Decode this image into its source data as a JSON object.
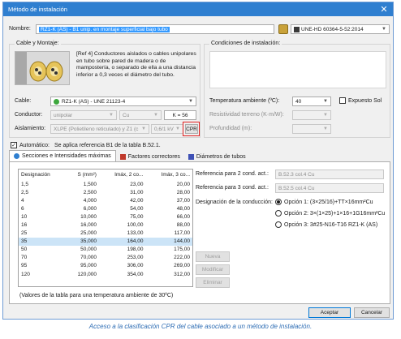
{
  "window": {
    "title": "Método de instalación",
    "close_glyph": "✕"
  },
  "nombre": {
    "label": "Nombre:",
    "value": "RZ1-K (AS) - B1 unip. en montaje superficial bajo tubo",
    "standard": "UNE-HD 60364-5-52:2014"
  },
  "cable_montaje": {
    "title": "Cable y Montaje:",
    "ref_text": "[Ref 4] Conductores aislados o cables unipolares en tubo sobre pared de madera o de mampostería, o separado de ella a una distancia inferior a 0,3 veces el diámetro del tubo.",
    "cable_label": "Cable:",
    "cable_value": "RZ1-K (AS) - UNE 21123-4",
    "conductor_label": "Conductor:",
    "conductor_value": "unipolar",
    "material_value": "Cu",
    "k_value": "K = 56",
    "aislamiento_label": "Aislamiento:",
    "aislamiento_value": "XLPE (Polietileno reticulado) y Z1 (c",
    "voltage_value": "0,6/1 kV",
    "cpr_label": "CPR"
  },
  "condiciones": {
    "title": "Condiciones de instalación:",
    "temp_label": "Temperatura ambiente (ºC):",
    "temp_value": "40",
    "expuesto_label": "Expuesto Sol",
    "resistividad_label": "Resistividad terreno (K·m/W):",
    "profundidad_label": "Profundidad (m):"
  },
  "automatico": {
    "label": "Automático:",
    "text": "Se aplica referencia B1 de la tabla B.52.1."
  },
  "tabs": [
    {
      "label": "Secciones e Intensidades máximas"
    },
    {
      "label": "Factores correctores"
    },
    {
      "label": "Diámetros de tubos"
    }
  ],
  "table": {
    "headers": [
      "Designación",
      "S (mm²)",
      "Imáx, 2 co...",
      "Imáx, 3 co..."
    ],
    "rows": [
      [
        "1,5",
        "1,500",
        "23,00",
        "20,00"
      ],
      [
        "2,5",
        "2,500",
        "31,00",
        "28,00"
      ],
      [
        "4",
        "4,000",
        "42,00",
        "37,00"
      ],
      [
        "6",
        "6,000",
        "54,00",
        "48,00"
      ],
      [
        "10",
        "10,000",
        "75,00",
        "66,00"
      ],
      [
        "16",
        "16,000",
        "100,00",
        "88,00"
      ],
      [
        "25",
        "25,000",
        "133,00",
        "117,00"
      ],
      [
        "35",
        "35,000",
        "164,00",
        "144,00"
      ],
      [
        "50",
        "50,000",
        "198,00",
        "175,00"
      ],
      [
        "70",
        "70,000",
        "253,00",
        "222,00"
      ],
      [
        "95",
        "95,000",
        "306,00",
        "269,00"
      ],
      [
        "120",
        "120,000",
        "354,00",
        "312,00"
      ]
    ],
    "selected_row": 7,
    "footnote": "(Valores de la tabla para una temperatura ambiente de 30ºC)"
  },
  "right_panel": {
    "ref2_label": "Referencia para 2 cond. act.:",
    "ref2_value": "B.52.3 col.4 Cu",
    "ref3_label": "Referencia para 3 cond. act.:",
    "ref3_value": "B.52.5 col.4 Cu",
    "designacion_label": "Designación de la conducción:",
    "options": [
      {
        "label": "Opción 1: (3×25/16)+TT×16mm²Cu",
        "checked": true
      },
      {
        "label": "Opción 2: 3×(1×25)+1×16+1G16mm²Cu",
        "checked": false
      },
      {
        "label": "Opción 3: 3#25-N16-T16 RZ1-K (AS)",
        "checked": false
      }
    ],
    "nueva": "Nueva",
    "modificar": "Modificar",
    "eliminar": "Eliminar"
  },
  "buttons": {
    "accept": "Aceptar",
    "cancel": "Cancelar"
  },
  "caption": "Acceso a la clasificación CPR del cable asociado a un método de instalación.",
  "colors": {
    "titlebar": "#2f7fd0",
    "cpr_highlight": "#e02020",
    "caption": "#2e6db4",
    "selection": "#3399ff"
  }
}
